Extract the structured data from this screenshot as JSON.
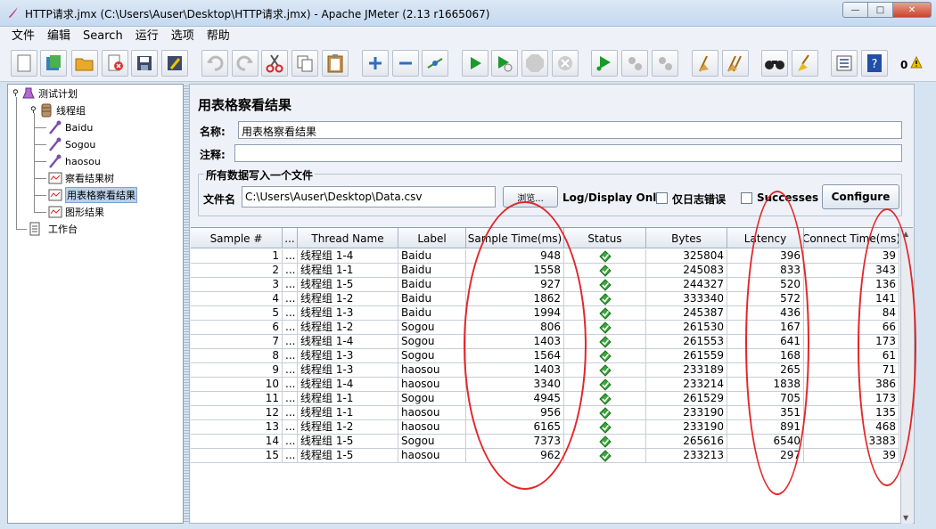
{
  "window": {
    "title": "HTTP请求.jmx (C:\\Users\\Auser\\Desktop\\HTTP请求.jmx) - Apache JMeter (2.13 r1665067)",
    "min": "—",
    "max": "□",
    "close": "✕"
  },
  "menu": [
    "文件",
    "编辑",
    "Search",
    "运行",
    "选项",
    "帮助"
  ],
  "toolbar": {
    "buttons": [
      "new-icon",
      "templates-icon",
      "open-icon",
      "close-icon",
      "save-icon",
      "save-as-icon",
      "undo-icon",
      "redo-icon",
      "cut-icon",
      "copy-icon",
      "paste-icon",
      "expand-icon",
      "collapse-icon",
      "toggle-icon",
      "start-icon",
      "start-no-timers-icon",
      "stop-icon",
      "shutdown-icon",
      "remote-start-icon",
      "remote-stop-icon",
      "remote-shutdown-icon",
      "clear-icon",
      "clear-all-icon",
      "search-icon",
      "reset-search-icon",
      "function-helper-icon",
      "help-icon"
    ],
    "error_count": "0"
  },
  "tree": {
    "items": [
      {
        "label": "测试计划",
        "icon": "test-plan-icon"
      },
      {
        "label": "线程组",
        "icon": "thread-group-icon"
      },
      {
        "label": "Baidu",
        "icon": "sampler-icon"
      },
      {
        "label": "Sogou",
        "icon": "sampler-icon"
      },
      {
        "label": "haosou",
        "icon": "sampler-icon"
      },
      {
        "label": "察看结果树",
        "icon": "listener-icon"
      },
      {
        "label": "用表格察看结果",
        "icon": "listener-icon"
      },
      {
        "label": "图形结果",
        "icon": "listener-icon"
      },
      {
        "label": "工作台",
        "icon": "workbench-icon"
      }
    ]
  },
  "panel": {
    "title": "用表格察看结果",
    "name_label": "名称:",
    "name_value": "用表格察看结果",
    "comment_label": "注释:",
    "comment_value": "",
    "file_group_title": "所有数据写入一个文件",
    "filename_label": "文件名",
    "filename_value": "C:\\Users\\Auser\\Desktop\\Data.csv",
    "browse_label": "浏览...",
    "log_display_label": "Log/Display Only:",
    "errors_label": "仅日志错误",
    "successes_label": "Successes",
    "configure_label": "Configure"
  },
  "table": {
    "columns": [
      "Sample #",
      "...",
      "Thread Name",
      "Label",
      "Sample Time(ms)",
      "Status",
      "Bytes",
      "Latency",
      "Connect Time(ms)"
    ],
    "rows": [
      {
        "n": "1",
        "start": "...",
        "thread": "线程组 1-4",
        "label": "Baidu",
        "time": "948",
        "bytes": "325804",
        "latency": "396",
        "connect": "39"
      },
      {
        "n": "2",
        "start": "...",
        "thread": "线程组 1-1",
        "label": "Baidu",
        "time": "1558",
        "bytes": "245083",
        "latency": "833",
        "connect": "343"
      },
      {
        "n": "3",
        "start": "...",
        "thread": "线程组 1-5",
        "label": "Baidu",
        "time": "927",
        "bytes": "244327",
        "latency": "520",
        "connect": "136"
      },
      {
        "n": "4",
        "start": "...",
        "thread": "线程组 1-2",
        "label": "Baidu",
        "time": "1862",
        "bytes": "333340",
        "latency": "572",
        "connect": "141"
      },
      {
        "n": "5",
        "start": "...",
        "thread": "线程组 1-3",
        "label": "Baidu",
        "time": "1994",
        "bytes": "245387",
        "latency": "436",
        "connect": "84"
      },
      {
        "n": "6",
        "start": "...",
        "thread": "线程组 1-2",
        "label": "Sogou",
        "time": "806",
        "bytes": "261530",
        "latency": "167",
        "connect": "66"
      },
      {
        "n": "7",
        "start": "...",
        "thread": "线程组 1-4",
        "label": "Sogou",
        "time": "1403",
        "bytes": "261553",
        "latency": "641",
        "connect": "173"
      },
      {
        "n": "8",
        "start": "...",
        "thread": "线程组 1-3",
        "label": "Sogou",
        "time": "1564",
        "bytes": "261559",
        "latency": "168",
        "connect": "61"
      },
      {
        "n": "9",
        "start": "...",
        "thread": "线程组 1-3",
        "label": "haosou",
        "time": "1403",
        "bytes": "233189",
        "latency": "265",
        "connect": "71"
      },
      {
        "n": "10",
        "start": "...",
        "thread": "线程组 1-4",
        "label": "haosou",
        "time": "3340",
        "bytes": "233214",
        "latency": "1838",
        "connect": "386"
      },
      {
        "n": "11",
        "start": "...",
        "thread": "线程组 1-1",
        "label": "Sogou",
        "time": "4945",
        "bytes": "261529",
        "latency": "705",
        "connect": "173"
      },
      {
        "n": "12",
        "start": "...",
        "thread": "线程组 1-1",
        "label": "haosou",
        "time": "956",
        "bytes": "233190",
        "latency": "351",
        "connect": "135"
      },
      {
        "n": "13",
        "start": "...",
        "thread": "线程组 1-2",
        "label": "haosou",
        "time": "6165",
        "bytes": "233190",
        "latency": "891",
        "connect": "468"
      },
      {
        "n": "14",
        "start": "...",
        "thread": "线程组 1-5",
        "label": "Sogou",
        "time": "7373",
        "bytes": "265616",
        "latency": "6540",
        "connect": "3383"
      },
      {
        "n": "15",
        "start": "...",
        "thread": "线程组 1-5",
        "label": "haosou",
        "time": "962",
        "bytes": "233213",
        "latency": "297",
        "connect": "39"
      }
    ]
  },
  "colors": {
    "annotation": "#e3262a",
    "status_ok": "#3aa83a"
  }
}
